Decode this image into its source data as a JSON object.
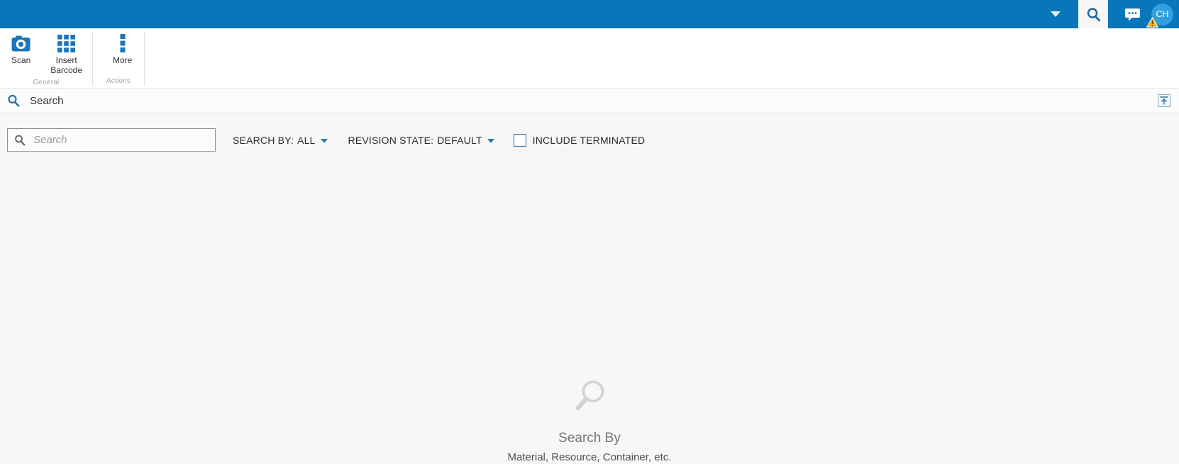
{
  "topbar": {
    "avatar_initials": "CH",
    "icons": {
      "dropdown": "chevron-down-icon",
      "search": "magnifier-icon",
      "chat": "chat-bubble-icon",
      "warning": "warning-triangle-icon"
    }
  },
  "ribbon": {
    "groups": [
      {
        "label": "General",
        "buttons": [
          {
            "label": "Scan",
            "icon": "camera-icon"
          },
          {
            "label": "Insert Barcode",
            "icon": "barcode-grid-icon"
          }
        ]
      },
      {
        "label": "Actions",
        "buttons": [
          {
            "label": "More",
            "icon": "more-vertical-icon"
          }
        ]
      }
    ]
  },
  "section_header": {
    "title": "Search",
    "left_icon": "magnifier-icon",
    "right_icon": "panel-expand-up-icon"
  },
  "filters": {
    "search_input": {
      "value": "",
      "placeholder": "Search",
      "icon": "magnifier-icon"
    },
    "search_by": {
      "label": "SEARCH BY:",
      "value": "ALL"
    },
    "revision_state": {
      "label": "REVISION STATE:",
      "value": "DEFAULT"
    },
    "include_terminated": {
      "label": "INCLUDE TERMINATED",
      "checked": false
    }
  },
  "empty_state": {
    "icon": "magnifier-icon",
    "title": "Search By",
    "subtitle": "Material, Resource, Container, etc."
  },
  "colors": {
    "topbar_blue": "#0776ba",
    "icon_blue": "#1c75b8",
    "avatar_blue": "#2fa0dd",
    "warning_yellow": "#f0b11d",
    "text_dark": "#333333",
    "muted_gray": "#a3a3a3",
    "content_bg": "#f7f7f7"
  }
}
